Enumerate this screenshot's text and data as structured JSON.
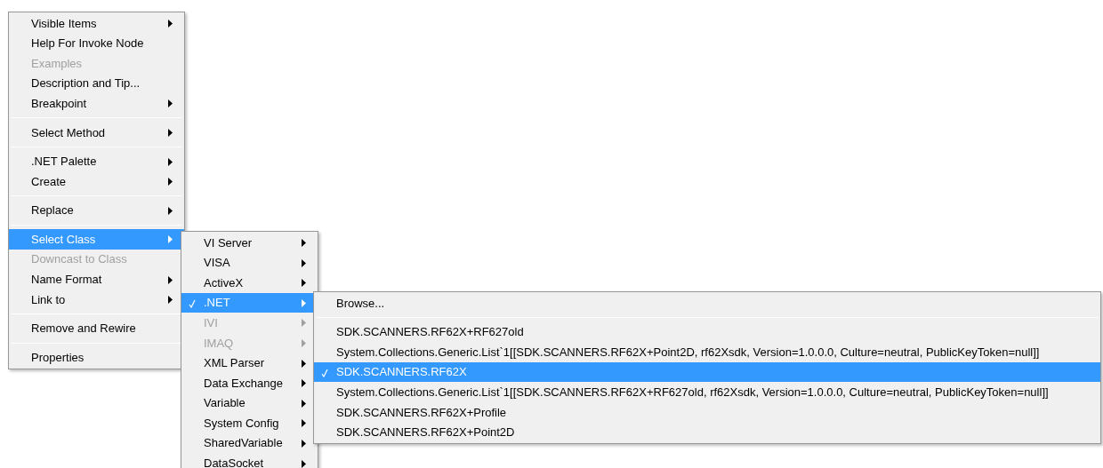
{
  "menus": [
    {
      "items": [
        {
          "kind": "item",
          "label": "Visible Items",
          "submenu": true,
          "disabled": false,
          "selected": false,
          "checked": false
        },
        {
          "kind": "item",
          "label": "Help For Invoke Node",
          "submenu": false,
          "disabled": false,
          "selected": false,
          "checked": false
        },
        {
          "kind": "item",
          "label": "Examples",
          "submenu": false,
          "disabled": true,
          "selected": false,
          "checked": false
        },
        {
          "kind": "item",
          "label": "Description and Tip...",
          "submenu": false,
          "disabled": false,
          "selected": false,
          "checked": false
        },
        {
          "kind": "item",
          "label": "Breakpoint",
          "submenu": true,
          "disabled": false,
          "selected": false,
          "checked": false
        },
        {
          "kind": "separator"
        },
        {
          "kind": "item",
          "label": "Select Method",
          "submenu": true,
          "disabled": false,
          "selected": false,
          "checked": false
        },
        {
          "kind": "separator"
        },
        {
          "kind": "item",
          "label": ".NET Palette",
          "submenu": true,
          "disabled": false,
          "selected": false,
          "checked": false
        },
        {
          "kind": "item",
          "label": "Create",
          "submenu": true,
          "disabled": false,
          "selected": false,
          "checked": false
        },
        {
          "kind": "separator"
        },
        {
          "kind": "item",
          "label": "Replace",
          "submenu": true,
          "disabled": false,
          "selected": false,
          "checked": false
        },
        {
          "kind": "separator"
        },
        {
          "kind": "item",
          "label": "Select Class",
          "submenu": true,
          "disabled": false,
          "selected": true,
          "checked": false
        },
        {
          "kind": "item",
          "label": "Downcast to Class",
          "submenu": false,
          "disabled": true,
          "selected": false,
          "checked": false
        },
        {
          "kind": "item",
          "label": "Name Format",
          "submenu": true,
          "disabled": false,
          "selected": false,
          "checked": false
        },
        {
          "kind": "item",
          "label": "Link to",
          "submenu": true,
          "disabled": false,
          "selected": false,
          "checked": false
        },
        {
          "kind": "separator"
        },
        {
          "kind": "item",
          "label": "Remove and Rewire",
          "submenu": false,
          "disabled": false,
          "selected": false,
          "checked": false
        },
        {
          "kind": "separator"
        },
        {
          "kind": "item",
          "label": "Properties",
          "submenu": false,
          "disabled": false,
          "selected": false,
          "checked": false
        }
      ]
    },
    {
      "items": [
        {
          "kind": "item",
          "label": "VI Server",
          "submenu": true,
          "disabled": false,
          "selected": false,
          "checked": false
        },
        {
          "kind": "item",
          "label": "VISA",
          "submenu": true,
          "disabled": false,
          "selected": false,
          "checked": false
        },
        {
          "kind": "item",
          "label": "ActiveX",
          "submenu": true,
          "disabled": false,
          "selected": false,
          "checked": false
        },
        {
          "kind": "item",
          "label": ".NET",
          "submenu": true,
          "disabled": false,
          "selected": true,
          "checked": true
        },
        {
          "kind": "item",
          "label": "IVI",
          "submenu": true,
          "disabled": true,
          "selected": false,
          "checked": false
        },
        {
          "kind": "item",
          "label": "IMAQ",
          "submenu": true,
          "disabled": true,
          "selected": false,
          "checked": false
        },
        {
          "kind": "item",
          "label": "XML Parser",
          "submenu": true,
          "disabled": false,
          "selected": false,
          "checked": false
        },
        {
          "kind": "item",
          "label": "Data Exchange",
          "submenu": true,
          "disabled": false,
          "selected": false,
          "checked": false
        },
        {
          "kind": "item",
          "label": "Variable",
          "submenu": true,
          "disabled": false,
          "selected": false,
          "checked": false
        },
        {
          "kind": "item",
          "label": "System Config",
          "submenu": true,
          "disabled": false,
          "selected": false,
          "checked": false
        },
        {
          "kind": "item",
          "label": "SharedVariable",
          "submenu": true,
          "disabled": false,
          "selected": false,
          "checked": false
        },
        {
          "kind": "item",
          "label": "DataSocket",
          "submenu": true,
          "disabled": false,
          "selected": false,
          "checked": false
        }
      ]
    },
    {
      "items": [
        {
          "kind": "item",
          "label": "Browse...",
          "submenu": false,
          "disabled": false,
          "selected": false,
          "checked": false
        },
        {
          "kind": "separator"
        },
        {
          "kind": "item",
          "label": "SDK.SCANNERS.RF62X+RF627old",
          "submenu": false,
          "disabled": false,
          "selected": false,
          "checked": false
        },
        {
          "kind": "item",
          "label": "System.Collections.Generic.List`1[[SDK.SCANNERS.RF62X+Point2D, rf62Xsdk, Version=1.0.0.0, Culture=neutral, PublicKeyToken=null]]",
          "submenu": false,
          "disabled": false,
          "selected": false,
          "checked": false
        },
        {
          "kind": "item",
          "label": "SDK.SCANNERS.RF62X",
          "submenu": false,
          "disabled": false,
          "selected": true,
          "checked": true
        },
        {
          "kind": "item",
          "label": "System.Collections.Generic.List`1[[SDK.SCANNERS.RF62X+RF627old, rf62Xsdk, Version=1.0.0.0, Culture=neutral, PublicKeyToken=null]]",
          "submenu": false,
          "disabled": false,
          "selected": false,
          "checked": false
        },
        {
          "kind": "item",
          "label": "SDK.SCANNERS.RF62X+Profile",
          "submenu": false,
          "disabled": false,
          "selected": false,
          "checked": false
        },
        {
          "kind": "item",
          "label": "SDK.SCANNERS.RF62X+Point2D",
          "submenu": false,
          "disabled": false,
          "selected": false,
          "checked": false
        }
      ]
    }
  ]
}
